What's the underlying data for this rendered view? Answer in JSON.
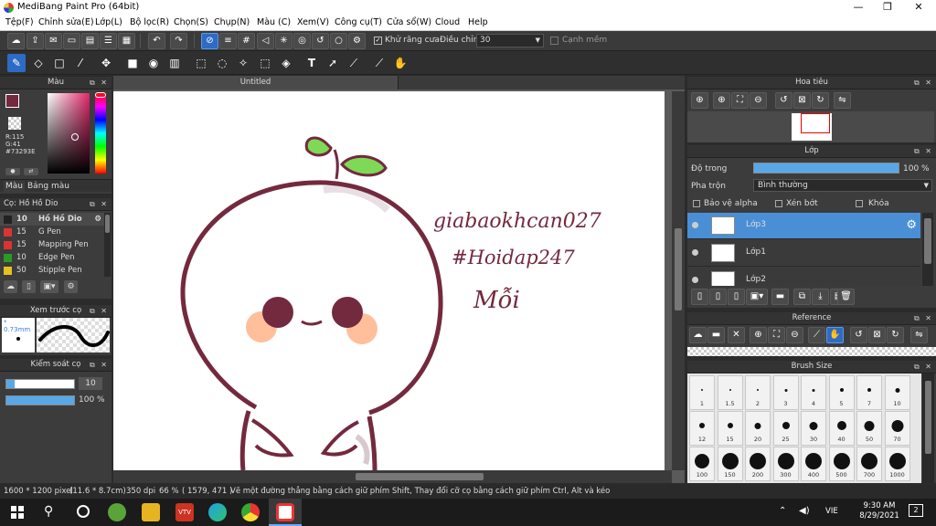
{
  "window": {
    "title": "MediBang Paint Pro (64bit)",
    "minimize": "—",
    "maximize": "❐",
    "close": "✕"
  },
  "menu": [
    "Tệp(F)",
    "Chỉnh sửa(E)",
    "Lớp(L)",
    "Bộ lọc(R)",
    "Chọn(S)",
    "Chụp(N)",
    "Màu (C)",
    "Xem(V)",
    "Công cụ(T)",
    "Cửa sổ(W)",
    "Cloud",
    "Help"
  ],
  "toolbar1": {
    "antialias_label": "Khử răng cưa",
    "correction_label": "Điều chỉnh",
    "correction_value": "30",
    "edge_label": "Cạnh mềm"
  },
  "canvas": {
    "tab_title": "Untitled"
  },
  "handwriting": {
    "line1": "giabaokhcan027",
    "line2": "#Hoidap247",
    "line3": "Mỗi"
  },
  "color_panel": {
    "title": "Màu",
    "rgb_r": "R:115",
    "rgb_g": "G:41",
    "hex": "#73293E",
    "tab_color": "Màu",
    "tab_palette": "Bảng màu",
    "primary_color": "#73293E"
  },
  "brush_panel": {
    "title": "Cọ: Hồ Hồ Dio",
    "brushes": [
      {
        "size": "10",
        "name": "Hồ Hồ Dio",
        "color": "#222222"
      },
      {
        "size": "15",
        "name": "G Pen",
        "color": "#d33"
      },
      {
        "size": "15",
        "name": "Mapping Pen",
        "color": "#d33"
      },
      {
        "size": "10",
        "name": "Edge Pen",
        "color": "#2a9a2a"
      },
      {
        "size": "50",
        "name": "Stipple Pen",
        "color": "#e8c020"
      }
    ]
  },
  "preview_panel": {
    "title": "Xem trước cọ",
    "size_label": "* 0.73mm"
  },
  "control_panel": {
    "title": "Kiểm soát cọ",
    "size_value": "10",
    "opacity_value": "100 %",
    "size_fraction": 0.1,
    "opacity_fraction": 1.0
  },
  "navigator": {
    "title": "Hoa tiêu"
  },
  "layer_panel": {
    "title": "Lớp",
    "opacity_label": "Độ trong",
    "opacity_value": "100 %",
    "blend_label": "Pha trộn",
    "blend_value": "Bình thường",
    "protect_alpha": "Bảo vệ alpha",
    "clipping": "Xén bớt",
    "lock": "Khóa",
    "layers": [
      {
        "name": "Lớp3",
        "selected": true
      },
      {
        "name": "Lớp1",
        "selected": false
      },
      {
        "name": "Lớp2",
        "selected": false
      }
    ]
  },
  "reference_panel": {
    "title": "Reference"
  },
  "brush_size_panel": {
    "title": "Brush Size",
    "sizes": [
      "1",
      "1.5",
      "2",
      "3",
      "4",
      "5",
      "7",
      "10",
      "12",
      "15",
      "20",
      "25",
      "30",
      "40",
      "50",
      "70",
      "100",
      "150",
      "200",
      "300",
      "400",
      "500",
      "700",
      "1000"
    ]
  },
  "status": {
    "dimensions": "1600 * 1200 pixel",
    "physical": "(11.6 * 8.7cm)",
    "dpi": "350 dpi",
    "zoom": "66 %",
    "cursor": "( 1579, 471 )",
    "hint": "Vẽ một đường thẳng bằng cách giữ phím Shift, Thay đổi cỡ cọ bằng cách giữ phím Ctrl, Alt và kéo"
  },
  "taskbar": {
    "time": "9:30 AM",
    "date": "8/29/2021",
    "lang": "VIE",
    "notif": "2"
  }
}
